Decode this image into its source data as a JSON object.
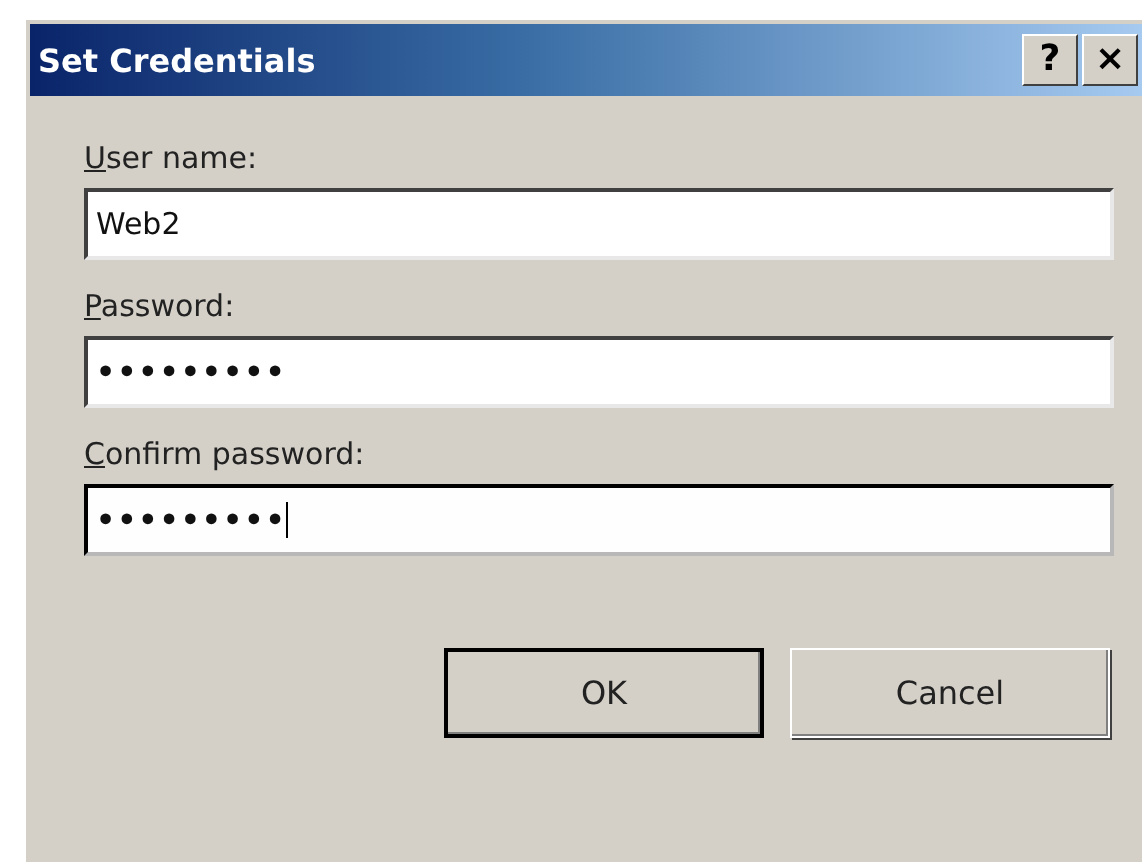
{
  "window": {
    "title": "Set Credentials",
    "buttons": [
      "?",
      "×"
    ]
  },
  "fields": [
    {
      "label": "User name:",
      "value": "Web2",
      "focused": false
    },
    {
      "label": "Password:",
      "value": "•••••••••",
      "focused": false
    },
    {
      "label": "Confirm password:",
      "value": "•••••••••",
      "focused": true
    }
  ],
  "buttons": [
    {
      "label": "OK",
      "default": true
    },
    {
      "label": "Cancel",
      "default": false
    }
  ]
}
